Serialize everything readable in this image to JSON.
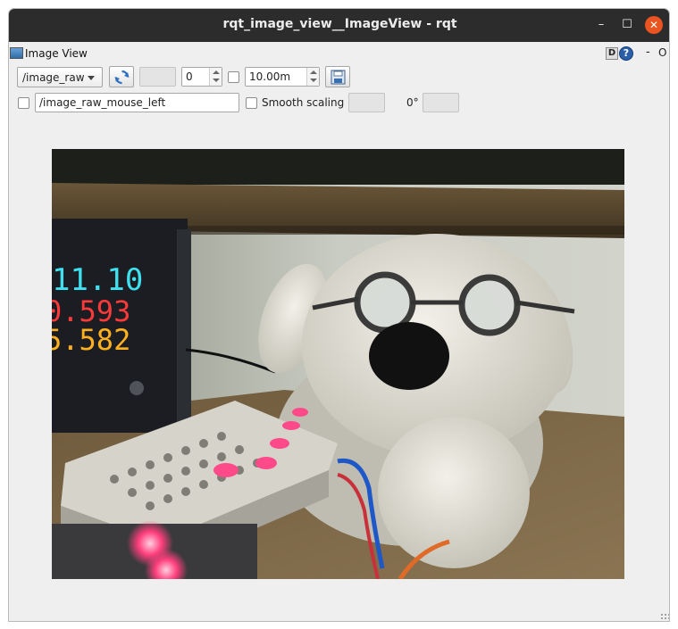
{
  "window": {
    "title": "rqt_image_view__ImageView - rqt",
    "minimize_label": "–",
    "maximize_label": "☐",
    "close_label": "✕"
  },
  "dock": {
    "title": "Image View",
    "d_button": "D",
    "help_button": "?",
    "dash_button": "-",
    "float_button": "O"
  },
  "toolbar": {
    "topic_selected": "/image_raw",
    "spin_value": "0",
    "max_range_value": "10.00m",
    "mouse_topic_value": "/image_raw_mouse_left",
    "smooth_label": "Smooth scaling",
    "rotation_label": "0°"
  },
  "colors": {
    "titlebar": "#2c2c2c",
    "close_button": "#e95420",
    "panel_bg": "#efefef"
  },
  "image": {
    "display1": "11.10",
    "display2": "0.593",
    "display3": "5.582"
  }
}
